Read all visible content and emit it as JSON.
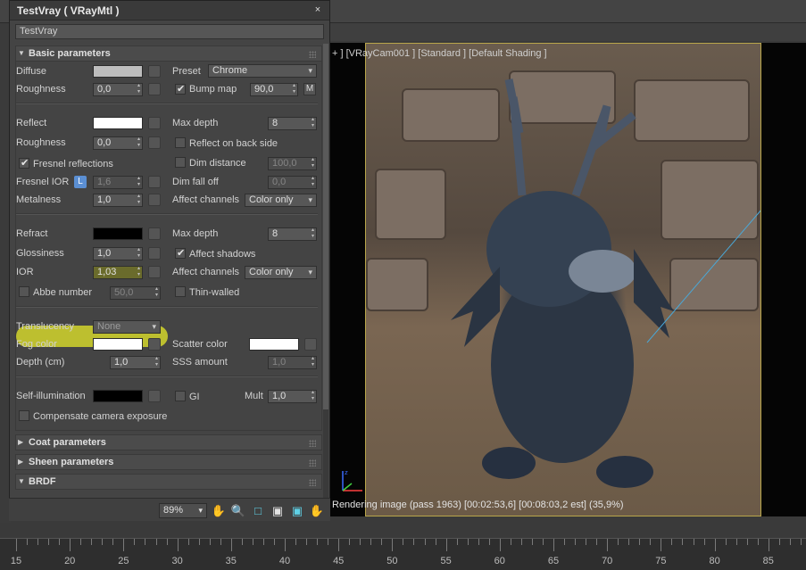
{
  "panel": {
    "title": "TestVray  ( VRayMtl )",
    "close_glyph": "×",
    "material_name": "TestVray"
  },
  "basic": {
    "header": "Basic parameters",
    "diffuse_label": "Diffuse",
    "diffuse_color": "#bdbdbd",
    "preset_label": "Preset",
    "preset_value": "Chrome",
    "roughness_label": "Roughness",
    "roughness_value": "0,0",
    "bump_map_label": "Bump map",
    "bump_map_value": "90,0",
    "bump_m": "M",
    "reflect_label": "Reflect",
    "reflect_color": "#ffffff",
    "max_depth_label": "Max depth",
    "reflect_max_depth": "8",
    "refl_roughness_label": "Roughness",
    "refl_roughness_value": "0,0",
    "reflect_back_label": "Reflect on back side",
    "fresnel_label": "Fresnel reflections",
    "dim_distance_label": "Dim distance",
    "dim_distance_value": "100,0",
    "fresnel_ior_label": "Fresnel IOR",
    "fresnel_lock": "L",
    "fresnel_ior_value": "1,6",
    "dim_falloff_label": "Dim fall off",
    "dim_falloff_value": "0,0",
    "metalness_label": "Metalness",
    "metalness_value": "1,0",
    "affect_channels_label": "Affect channels",
    "reflect_affect_value": "Color only",
    "refract_label": "Refract",
    "refract_color": "#000000",
    "refract_max_depth_label": "Max depth",
    "refract_max_depth": "8",
    "glossiness_label": "Glossiness",
    "glossiness_value": "1,0",
    "affect_shadows_label": "Affect shadows",
    "ior_label": "IOR",
    "ior_value": "1,03",
    "refract_affect_label": "Affect channels",
    "refract_affect_value": "Color only",
    "abbe_label": "Abbe number",
    "abbe_value": "50,0",
    "thin_walled_label": "Thin-walled",
    "translucency_label": "Translucency",
    "translucency_value": "None",
    "fog_color_label": "Fog color",
    "fog_color": "#ffffff",
    "scatter_color_label": "Scatter color",
    "scatter_color": "#ffffff",
    "depth_label": "Depth (cm)",
    "depth_value": "1,0",
    "sss_label": "SSS amount",
    "sss_value": "1,0",
    "self_illum_label": "Self-illumination",
    "self_illum_color": "#000000",
    "gi_label": "GI",
    "mult_label": "Mult",
    "mult_value": "1,0",
    "compensate_label": "Compensate camera exposure"
  },
  "rollouts": {
    "coat": "Coat parameters",
    "sheen": "Sheen parameters",
    "brdf": "BRDF"
  },
  "toolbar": {
    "zoom": "89%"
  },
  "viewport": {
    "label": "+ ] [VRayCam001 ] [Standard ] [Default Shading ]",
    "status": "Rendering image (pass 1963) [00:02:53,6] [00:08:03,2 est]   (35,9%)"
  },
  "ruler": {
    "ticks": [
      "15",
      "20",
      "25",
      "30",
      "35",
      "40",
      "45",
      "50",
      "55",
      "60",
      "65",
      "70",
      "75",
      "80",
      "85"
    ]
  },
  "colors": {
    "highlight": "#e6e828",
    "lock_blue": "#5b8fd3",
    "frame_gold": "#b9a64a"
  }
}
